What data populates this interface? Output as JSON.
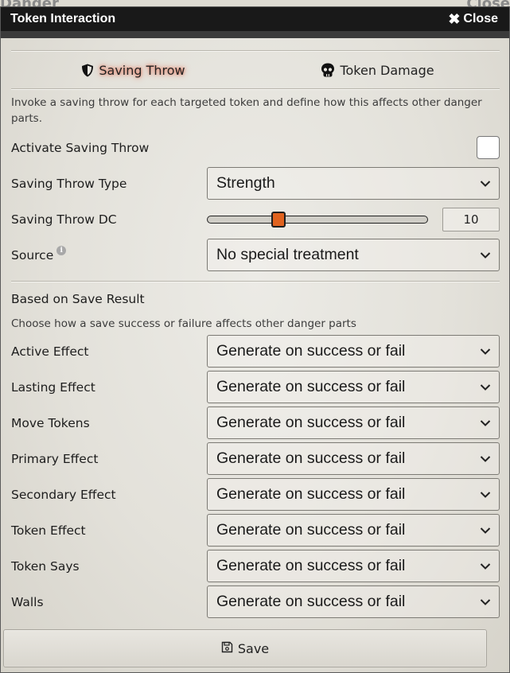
{
  "background_window": {
    "title": "Danger",
    "close_label": "Close"
  },
  "window": {
    "title": "Token Interaction",
    "close_label": "Close"
  },
  "tabs": [
    {
      "label": "Saving Throw",
      "icon": "shield-icon",
      "active": true
    },
    {
      "label": "Token Damage",
      "icon": "skull-icon",
      "active": false
    }
  ],
  "description": "Invoke a saving throw for each targeted token and define how this affects other danger parts.",
  "fields": {
    "activate": {
      "label": "Activate Saving Throw",
      "checked": false
    },
    "type": {
      "label": "Saving Throw Type",
      "value": "Strength"
    },
    "dc": {
      "label": "Saving Throw DC",
      "value": "10"
    },
    "source": {
      "label": "Source",
      "value": "No special treatment",
      "info_icon": "info-icon"
    }
  },
  "result_section": {
    "title": "Based on Save Result",
    "description": "Choose how a save success or failure affects other danger parts",
    "rows": [
      {
        "label": "Active Effect",
        "value": "Generate on success or fail"
      },
      {
        "label": "Lasting Effect",
        "value": "Generate on success or fail"
      },
      {
        "label": "Move Tokens",
        "value": "Generate on success or fail"
      },
      {
        "label": "Primary Effect",
        "value": "Generate on success or fail"
      },
      {
        "label": "Secondary Effect",
        "value": "Generate on success or fail"
      },
      {
        "label": "Token Effect",
        "value": "Generate on success or fail"
      },
      {
        "label": "Token Says",
        "value": "Generate on success or fail"
      },
      {
        "label": "Walls",
        "value": "Generate on success or fail"
      }
    ]
  },
  "save_button": {
    "label": "Save",
    "icon": "floppy-disk-icon"
  },
  "colors": {
    "titlebar": "#191919",
    "slider_thumb": "#e0621e",
    "active_tab_glow": "#e06a50"
  }
}
